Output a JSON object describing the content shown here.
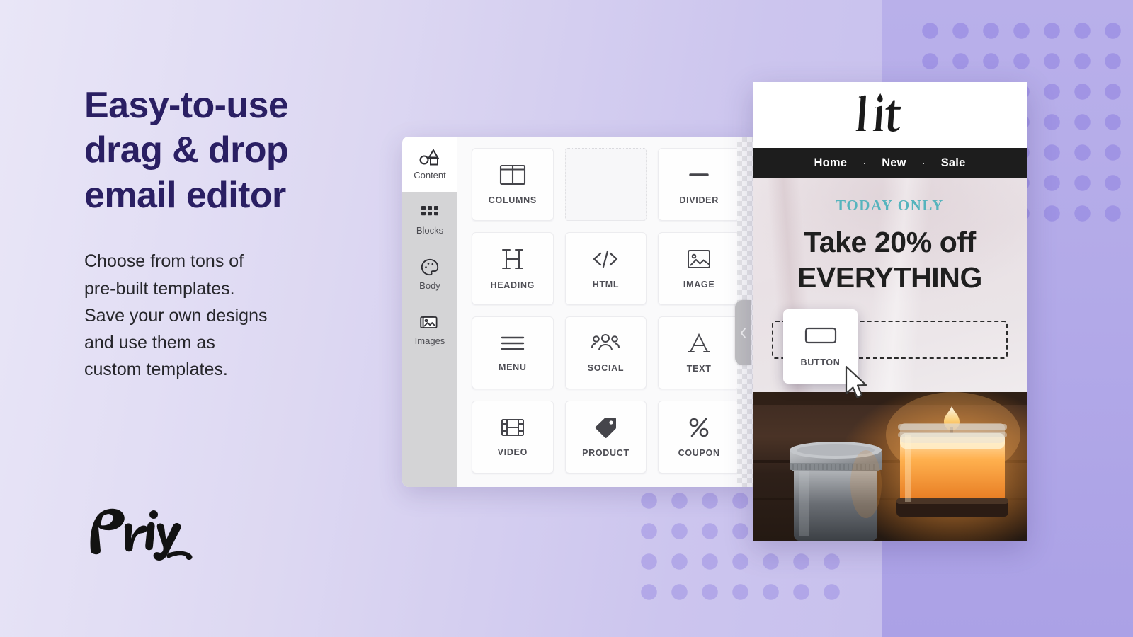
{
  "background": {
    "gradient_from": "#e9e6f7",
    "gradient_to": "#c3bbec",
    "band_color": "#b2a9e8",
    "dot_color": "#8e80e0"
  },
  "hero": {
    "headline_line1": "Easy-to-use",
    "headline_line2": "drag & drop",
    "headline_line3": "email editor",
    "headline_color": "#2a1f63",
    "subcopy_line1": "Choose from tons of",
    "subcopy_line2": "pre-built templates.",
    "subcopy_line3": "Save your own designs",
    "subcopy_line4": "and use them as",
    "subcopy_line5": "custom templates.",
    "subcopy_color": "#26262b"
  },
  "brand": {
    "name": "Privy",
    "color": "#111111"
  },
  "editor": {
    "sidebar": {
      "items": [
        {
          "label": "Content",
          "icon": "shapes-icon",
          "active": true
        },
        {
          "label": "Blocks",
          "icon": "grid-icon",
          "active": false
        },
        {
          "label": "Body",
          "icon": "palette-icon",
          "active": false
        },
        {
          "label": "Images",
          "icon": "images-icon",
          "active": false
        }
      ]
    },
    "blocks": [
      {
        "label": "COLUMNS",
        "icon": "columns-icon",
        "empty": false
      },
      {
        "label": "",
        "icon": "drop-slot",
        "empty": true
      },
      {
        "label": "DIVIDER",
        "icon": "divider-icon",
        "empty": false
      },
      {
        "label": "HEADING",
        "icon": "heading-icon",
        "empty": false
      },
      {
        "label": "HTML",
        "icon": "code-icon",
        "empty": false
      },
      {
        "label": "IMAGE",
        "icon": "image-icon",
        "empty": false
      },
      {
        "label": "MENU",
        "icon": "menu-icon",
        "empty": false
      },
      {
        "label": "SOCIAL",
        "icon": "social-icon",
        "empty": false
      },
      {
        "label": "TEXT",
        "icon": "text-icon",
        "empty": false
      },
      {
        "label": "VIDEO",
        "icon": "video-icon",
        "empty": false
      },
      {
        "label": "PRODUCT",
        "icon": "product-tag-icon",
        "empty": false
      },
      {
        "label": "COUPON",
        "icon": "coupon-percent-icon",
        "empty": false
      }
    ],
    "collapse_icon": "chevron-left-icon"
  },
  "drag": {
    "label": "BUTTON",
    "icon": "button-icon",
    "cursor": "pointer-arrow-cursor"
  },
  "email": {
    "logo_text": "lit",
    "nav": [
      {
        "label": "Home"
      },
      {
        "label": "New"
      },
      {
        "label": "Sale"
      }
    ],
    "nav_separator": "·",
    "nav_background": "#1d1d1d",
    "kicker": "TODAY ONLY",
    "kicker_color": "#56b4bd",
    "headline_line1": "Take 20% off",
    "headline_line2": "EVERYTHING",
    "headline_color": "#1f1f1f",
    "photo_alt": "candle-jars-photo"
  }
}
